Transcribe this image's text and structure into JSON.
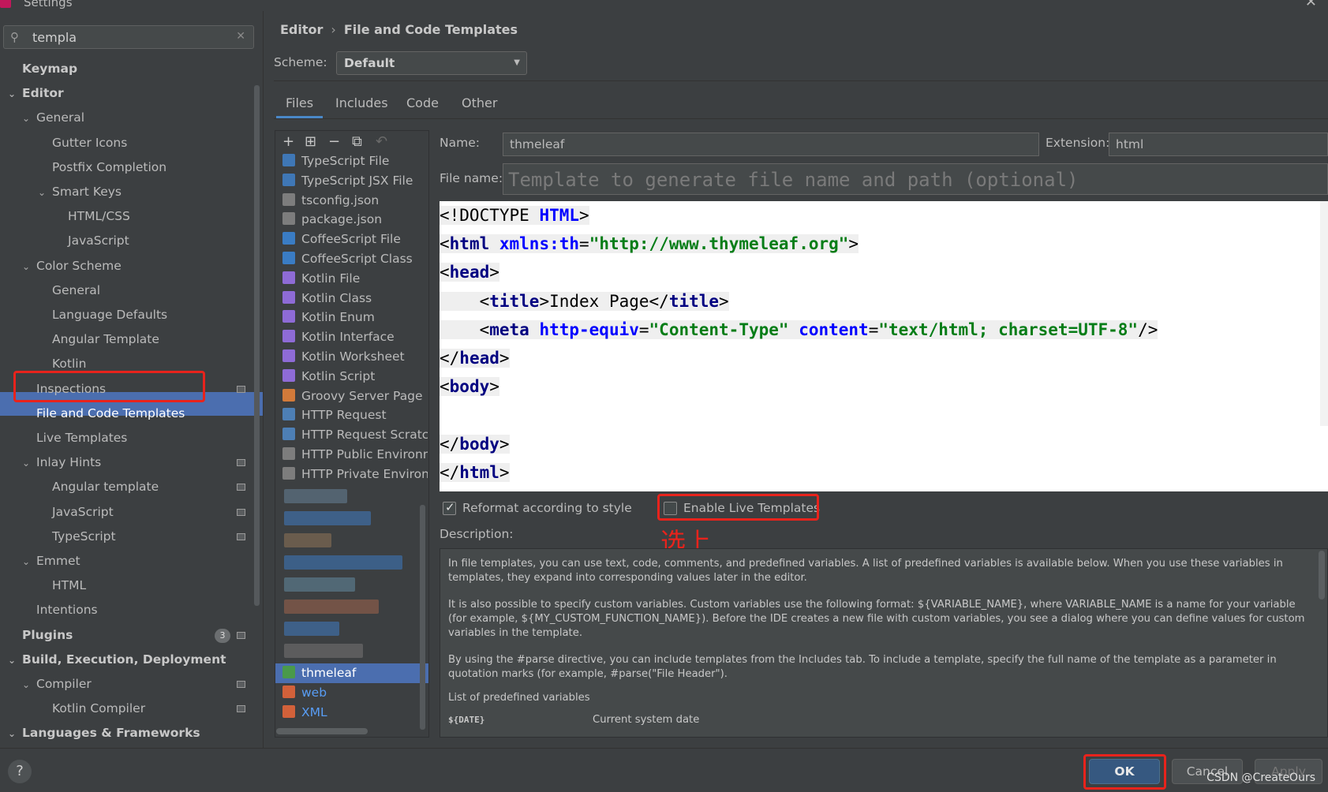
{
  "window": {
    "title": "Settings"
  },
  "search": {
    "value": "templa"
  },
  "tree": [
    {
      "label": "Keymap",
      "level": 0,
      "bold": true,
      "chevron": ""
    },
    {
      "label": "Editor",
      "level": 0,
      "bold": true,
      "chevron": "⌄"
    },
    {
      "label": "General",
      "level": 1,
      "chevron": "⌄"
    },
    {
      "label": "Gutter Icons",
      "level": 2,
      "chevron": ""
    },
    {
      "label": "Postfix Completion",
      "level": 2,
      "chevron": ""
    },
    {
      "label": "Smart Keys",
      "level": 2,
      "chevron": "⌄"
    },
    {
      "label": "HTML/CSS",
      "level": 3,
      "chevron": ""
    },
    {
      "label": "JavaScript",
      "level": 3,
      "chevron": ""
    },
    {
      "label": "Color Scheme",
      "level": 1,
      "chevron": "⌄"
    },
    {
      "label": "General",
      "level": 2,
      "chevron": ""
    },
    {
      "label": "Language Defaults",
      "level": 2,
      "chevron": ""
    },
    {
      "label": "Angular Template",
      "level": 2,
      "chevron": ""
    },
    {
      "label": "Kotlin",
      "level": 2,
      "chevron": ""
    },
    {
      "label": "Inspections",
      "level": 1,
      "chevron": "",
      "gear": true
    },
    {
      "label": "File and Code Templates",
      "level": 1,
      "chevron": "",
      "selected": true
    },
    {
      "label": "Live Templates",
      "level": 1,
      "chevron": ""
    },
    {
      "label": "Inlay Hints",
      "level": 1,
      "chevron": "⌄",
      "gear": true
    },
    {
      "label": "Angular template",
      "level": 2,
      "chevron": "",
      "gear": true
    },
    {
      "label": "JavaScript",
      "level": 2,
      "chevron": "",
      "gear": true
    },
    {
      "label": "TypeScript",
      "level": 2,
      "chevron": "",
      "gear": true
    },
    {
      "label": "Emmet",
      "level": 1,
      "chevron": "⌄"
    },
    {
      "label": "HTML",
      "level": 2,
      "chevron": ""
    },
    {
      "label": "Intentions",
      "level": 1,
      "chevron": ""
    },
    {
      "label": "Plugins",
      "level": 0,
      "bold": true,
      "chevron": "",
      "gear": true,
      "badge": "3"
    },
    {
      "label": "Build, Execution, Deployment",
      "level": 0,
      "bold": true,
      "chevron": "⌄"
    },
    {
      "label": "Compiler",
      "level": 1,
      "chevron": "⌄",
      "gear": true
    },
    {
      "label": "Kotlin Compiler",
      "level": 2,
      "chevron": "",
      "gear": true
    },
    {
      "label": "Languages & Frameworks",
      "level": 0,
      "bold": true,
      "chevron": "⌄"
    }
  ],
  "breadcrumb": {
    "parent": "Editor",
    "separator": "›",
    "current": "File and Code Templates"
  },
  "scheme": {
    "label": "Scheme:",
    "value": "Default"
  },
  "tabs": [
    {
      "label": "Files",
      "active": true
    },
    {
      "label": "Includes"
    },
    {
      "label": "Code"
    },
    {
      "label": "Other"
    }
  ],
  "toolbar": {
    "add": "+",
    "add_child": "⊞",
    "remove": "−",
    "copy": "⧉",
    "reset": "↶"
  },
  "templates": [
    {
      "label": "TypeScript File",
      "icon": "ts"
    },
    {
      "label": "TypeScript JSX File",
      "icon": "ts"
    },
    {
      "label": "tsconfig.json",
      "icon": "json"
    },
    {
      "label": "package.json",
      "icon": "json"
    },
    {
      "label": "CoffeeScript File",
      "icon": "coffee"
    },
    {
      "label": "CoffeeScript Class",
      "icon": "coffee"
    },
    {
      "label": "Kotlin File",
      "icon": "kt"
    },
    {
      "label": "Kotlin Class",
      "icon": "kt"
    },
    {
      "label": "Kotlin Enum",
      "icon": "kt"
    },
    {
      "label": "Kotlin Interface",
      "icon": "kt"
    },
    {
      "label": "Kotlin Worksheet",
      "icon": "kt"
    },
    {
      "label": "Kotlin Script",
      "icon": "kt"
    },
    {
      "label": "Groovy Server Page",
      "icon": "gsp"
    },
    {
      "label": "HTTP Request",
      "icon": "api"
    },
    {
      "label": "HTTP Request Scratch",
      "icon": "api"
    },
    {
      "label": "HTTP Public Environment",
      "icon": "json"
    },
    {
      "label": "HTTP Private Environment",
      "icon": "json"
    }
  ],
  "templates_bottom": [
    {
      "label": "thmeleaf",
      "icon": "html",
      "selected": true
    },
    {
      "label": "web",
      "icon": "xml",
      "blue": true
    },
    {
      "label": "XML",
      "icon": "xml",
      "blue": true
    }
  ],
  "form": {
    "name_label": "Name:",
    "name_value": "thmeleaf",
    "extension_label": "Extension:",
    "extension_value": "html",
    "filename_label": "File name:",
    "filename_placeholder": "Template to generate file name and path (optional)"
  },
  "code": [
    [
      {
        "t": "<!DOCTYPE ",
        "c": "pl"
      },
      {
        "t": "HTML",
        "c": "at"
      },
      {
        "t": ">",
        "c": "pl"
      }
    ],
    [
      {
        "t": "<",
        "c": "pl"
      },
      {
        "t": "html ",
        "c": "tg"
      },
      {
        "t": "xmlns:th",
        "c": "at"
      },
      {
        "t": "=",
        "c": "pl"
      },
      {
        "t": "\"http://www.thymeleaf.org\"",
        "c": "st"
      },
      {
        "t": ">",
        "c": "pl"
      }
    ],
    [
      {
        "t": "<",
        "c": "pl"
      },
      {
        "t": "head",
        "c": "tg"
      },
      {
        "t": ">",
        "c": "pl"
      }
    ],
    [
      {
        "t": "    <",
        "c": "pl"
      },
      {
        "t": "title",
        "c": "tg"
      },
      {
        "t": ">Index Page</",
        "c": "pl"
      },
      {
        "t": "title",
        "c": "tg"
      },
      {
        "t": ">",
        "c": "pl"
      }
    ],
    [
      {
        "t": "    <",
        "c": "pl"
      },
      {
        "t": "meta ",
        "c": "tg"
      },
      {
        "t": "http-equiv",
        "c": "at"
      },
      {
        "t": "=",
        "c": "pl"
      },
      {
        "t": "\"Content-Type\" ",
        "c": "st"
      },
      {
        "t": "content",
        "c": "at"
      },
      {
        "t": "=",
        "c": "pl"
      },
      {
        "t": "\"text/html; charset=UTF-8\"",
        "c": "st"
      },
      {
        "t": "/>",
        "c": "pl"
      }
    ],
    [
      {
        "t": "</",
        "c": "pl"
      },
      {
        "t": "head",
        "c": "tg"
      },
      {
        "t": ">",
        "c": "pl"
      }
    ],
    [
      {
        "t": "<",
        "c": "pl"
      },
      {
        "t": "body",
        "c": "tg"
      },
      {
        "t": ">",
        "c": "pl"
      }
    ],
    [],
    [
      {
        "t": "</",
        "c": "pl"
      },
      {
        "t": "body",
        "c": "tg"
      },
      {
        "t": ">",
        "c": "pl"
      }
    ],
    [
      {
        "t": "</",
        "c": "pl"
      },
      {
        "t": "html",
        "c": "tg"
      },
      {
        "t": ">",
        "c": "pl"
      }
    ]
  ],
  "options": {
    "reformat_label": "Reformat according to style",
    "reformat_checked": true,
    "live_templates_label": "Enable Live Templates",
    "live_templates_checked": false,
    "annotation": "选上"
  },
  "description": {
    "label": "Description:",
    "p1": "In file templates, you can use text, code, comments, and predefined variables. A list of predefined variables is available below. When you use these variables in templates, they expand into corresponding values later in the editor.",
    "p2": "It is also possible to specify custom variables. Custom variables use the following format: ${VARIABLE_NAME}, where VARIABLE_NAME is a name for your variable (for example, ${MY_CUSTOM_FUNCTION_NAME}). Before the IDE creates a new file with custom variables, you see a dialog where you can define values for custom variables in the template.",
    "p3": "By using the #parse directive, you can include templates from the Includes tab. To include a template, specify the full name of the template as a parameter in quotation marks (for example, #parse(\"File Header\").",
    "list_title": "List of predefined variables",
    "var_name": "${DATE}",
    "var_desc": "Current system date"
  },
  "buttons": {
    "help": "?",
    "ok": "OK",
    "cancel": "Cancel",
    "apply": "Apply"
  },
  "watermark": "CSDN @CreateOurs"
}
